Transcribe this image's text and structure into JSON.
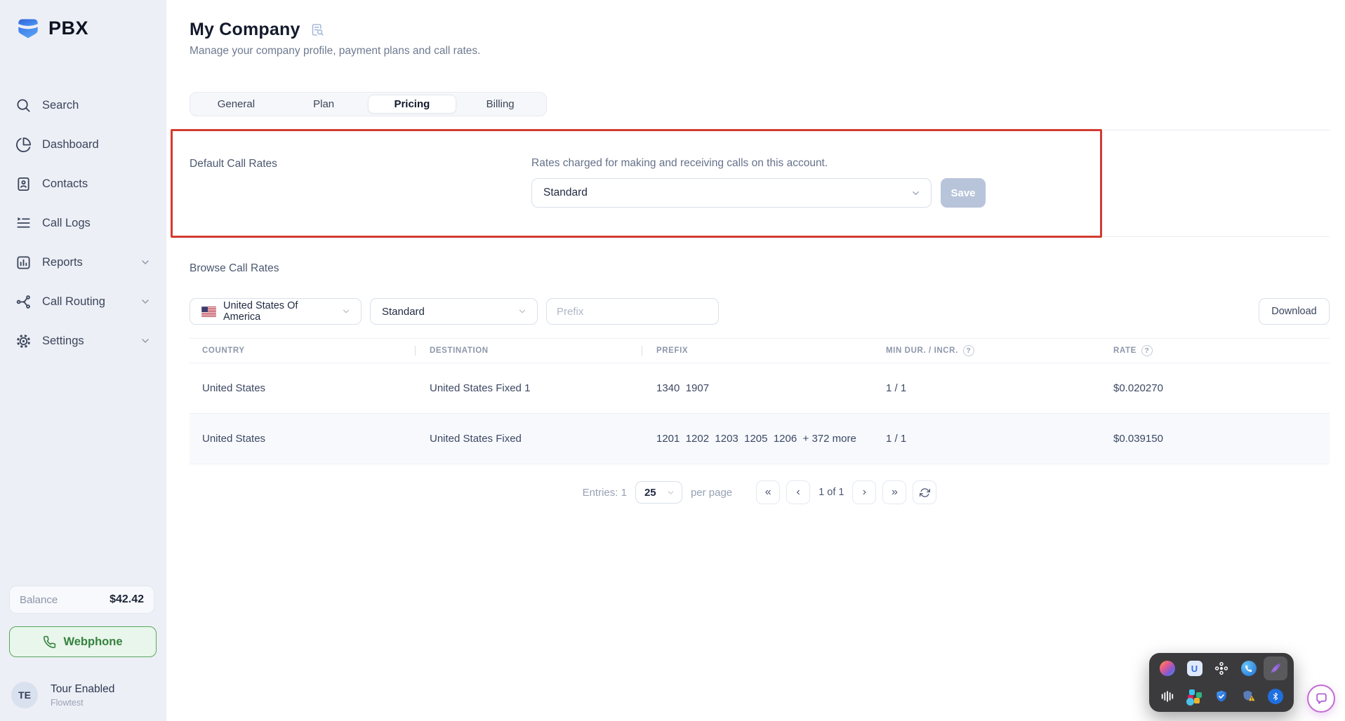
{
  "brand": {
    "name": "PBX"
  },
  "sidebar": {
    "items": [
      {
        "label": "Search",
        "icon": "search-icon"
      },
      {
        "label": "Dashboard",
        "icon": "dashboard-icon"
      },
      {
        "label": "Contacts",
        "icon": "contacts-icon"
      },
      {
        "label": "Call Logs",
        "icon": "call-logs-icon"
      },
      {
        "label": "Reports",
        "icon": "reports-icon",
        "expandable": true
      },
      {
        "label": "Call Routing",
        "icon": "call-routing-icon",
        "expandable": true
      },
      {
        "label": "Settings",
        "icon": "settings-icon",
        "expandable": true
      }
    ],
    "balance": {
      "label": "Balance",
      "value": "$42.42"
    },
    "webphone_label": "Webphone",
    "user": {
      "initials": "TE",
      "name": "Tour Enabled",
      "subtitle": "Flowtest"
    }
  },
  "header": {
    "title": "My Company",
    "subtitle": "Manage your company profile, payment plans and call rates."
  },
  "tabs": {
    "general": "General",
    "plan": "Plan",
    "pricing": "Pricing",
    "billing": "Billing",
    "active_tab": "Pricing"
  },
  "default_rates": {
    "label": "Default Call Rates",
    "description": "Rates charged for making and receiving calls on this account.",
    "selected_plan": "Standard",
    "save_label": "Save"
  },
  "browse": {
    "label": "Browse Call Rates",
    "country_value": "United States Of America",
    "plan_value": "Standard",
    "prefix_placeholder": "Prefix",
    "download_label": "Download"
  },
  "table": {
    "columns": {
      "country": "COUNTRY",
      "destination": "DESTINATION",
      "prefix": "PREFIX",
      "min_incr": "MIN DUR. / INCR.",
      "rate": "RATE"
    },
    "rows": [
      {
        "country": "United States",
        "destination": "United States Fixed 1",
        "prefix": "1340  1907",
        "min_incr": "1 / 1",
        "rate": "$0.020270"
      },
      {
        "country": "United States",
        "destination": "United States Fixed",
        "prefix": "1201  1202  1203  1205  1206  + 372 more",
        "min_incr": "1 / 1",
        "rate": "$0.039150"
      }
    ]
  },
  "pagination": {
    "entries": "Entries: 1",
    "per_page_value": "25",
    "per_page_suffix": "per page",
    "first": "«",
    "prev": "‹",
    "page_indicator": "1 of 1",
    "next": "›",
    "last": "»",
    "refresh_icon": "refresh-icon"
  },
  "tray": {
    "icons_row1": [
      "copilot-icon",
      "store-u-icon",
      "cluster-icon",
      "call-app-icon",
      "feather-icon"
    ],
    "icons_row2": [
      "soundbars-icon",
      "slack-icon",
      "shield-check-icon",
      "shield-warning-icon",
      "bluetooth-icon"
    ],
    "selected_icon": "feather-icon"
  },
  "chat": {
    "launcher_icon": "chat-bubble-icon"
  },
  "colors": {
    "annotation_red": "#d23b31",
    "brand_blue": "#3b76e8",
    "webphone_green": "#35823f",
    "save_disabled": "#b8c4da",
    "sidebar_bg": "#edeff6",
    "row_alt_bg": "#f7f9fd"
  }
}
